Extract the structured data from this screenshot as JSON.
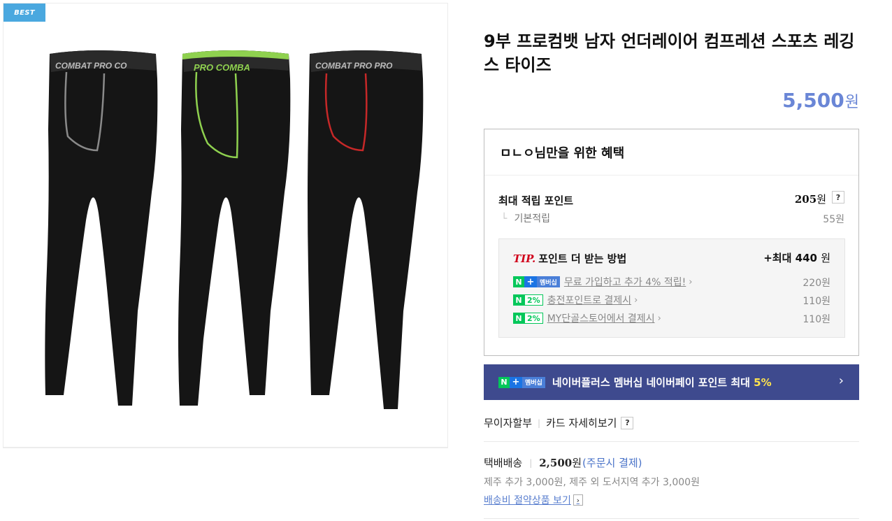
{
  "gallery": {
    "badge": "BEST",
    "image_alt": "compression tights pack"
  },
  "product": {
    "title": "9부 프로컴뱃 남자 언더레이어 컴프레션 스포츠 레깅스 타이즈",
    "price": "5,500",
    "price_unit": "원",
    "price_color": "#6a86d6"
  },
  "benefit": {
    "heading": "ㅁㄴㅇ님만을 위한 혜택",
    "max_point_label": "최대 적립 포인트",
    "max_point_value": "205",
    "max_point_unit": "원",
    "help_label": "?",
    "base_label": "기본적립",
    "base_value": "55원",
    "tip": {
      "tip_prefix": "TIP.",
      "title": "포인트 더 받는 방법",
      "max_prefix": "+최대",
      "max_value": "440",
      "max_unit": "원",
      "rows": [
        {
          "badge_n": "N",
          "badge_plus": "+",
          "badge_text": "멤버십",
          "text": "무료 가입하고 추가 4% 적립!",
          "value": "220원"
        },
        {
          "badge_n": "N",
          "badge_text": "2%",
          "text": "충전포인트로 결제시",
          "value": "110원"
        },
        {
          "badge_n": "N",
          "badge_text": "2%",
          "text": "MY단골스토어에서 결제시",
          "value": "110원"
        }
      ]
    }
  },
  "banner": {
    "badge_n": "N",
    "badge_plus": "+",
    "badge_text": "멤버십",
    "text": "네이버플러스 멤버십 네이버페이 포인트 최대",
    "highlight": "5%",
    "chevron": "›",
    "bg_color": "#3e4a8e"
  },
  "payment": {
    "installment": "무이자할부",
    "card_detail": "카드 자세히보기",
    "help_label": "?"
  },
  "shipping": {
    "method": "택배배송",
    "fee": "2,500",
    "fee_unit": "원",
    "condition": "(주문시 결제)",
    "note": "제주 추가 3,000원, 제주 외 도서지역 추가 3,000원",
    "link": "배송비 절약상품 보기",
    "link_chevron": "›"
  }
}
